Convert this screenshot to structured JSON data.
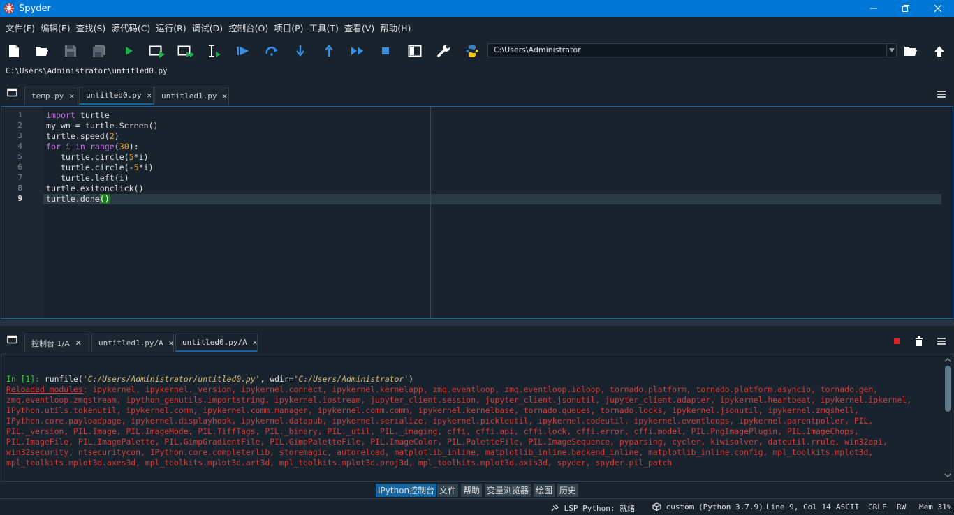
{
  "window": {
    "title": "Spyder"
  },
  "menu": [
    "文件(F)",
    "编辑(E)",
    "查找(S)",
    "源代码(C)",
    "运行(R)",
    "调试(D)",
    "控制台(O)",
    "项目(P)",
    "工具(T)",
    "查看(V)",
    "帮助(H)"
  ],
  "toolbar": {
    "working_dir": "C:\\Users\\Administrator"
  },
  "editor": {
    "file_path": "C:\\Users\\Administrator\\untitled0.py",
    "tabs": [
      {
        "label": "temp.py"
      },
      {
        "label": "untitled0.py",
        "active": true
      },
      {
        "label": "untitled1.py"
      }
    ],
    "current_line": 9,
    "lines": [
      "import turtle",
      "my_wn = turtle.Screen()",
      "turtle.speed(2)",
      "for i in range(30):",
      "   turtle.circle(5*i)",
      "   turtle.circle(-5*i)",
      "   turtle.left(i)",
      "turtle.exitonclick()",
      "turtle.done()"
    ]
  },
  "console": {
    "tabs": [
      {
        "label": "控制台 1/A"
      },
      {
        "label": "untitled1.py/A"
      },
      {
        "label": "untitled0.py/A",
        "active": true
      }
    ],
    "prompt": "In [1]:",
    "run_cmd_pre": " runfile(",
    "run_file_arg": "'C:/Users/Administrator/untitled0.py'",
    "run_mid": ", wdir=",
    "run_wdir_arg": "'C:/Users/Administrator'",
    "run_end": ")",
    "reloaded_label": "Reloaded modules",
    "reloaded_lines": [
      ": ipykernel, ipykernel._version, ipykernel.connect, ipykernel.kernelapp, zmq.eventloop, zmq.eventloop.ioloop, tornado.platform, tornado.platform.asyncio, tornado.gen,",
      "zmq.eventloop.zmqstream, ipython_genutils.importstring, ipykernel.iostream, jupyter_client.session, jupyter_client.jsonutil, jupyter_client.adapter, ipykernel.heartbeat, ipykernel.ipkernel,",
      "IPython.utils.tokenutil, ipykernel.comm, ipykernel.comm.manager, ipykernel.comm.comm, ipykernel.kernelbase, tornado.queues, tornado.locks, ipykernel.jsonutil, ipykernel.zmqshell,",
      "IPython.core.payloadpage, ipykernel.displayhook, ipykernel.datapub, ipykernel.serialize, ipykernel.pickleutil, ipykernel.codeutil, ipykernel.eventloops, ipykernel.parentpoller, PIL,",
      "PIL._version, PIL.Image, PIL.ImageMode, PIL.TiffTags, PIL._binary, PIL._util, PIL._imaging, cffi, cffi.api, cffi.lock, cffi.error, cffi.model, PIL.PngImagePlugin, PIL.ImageChops,",
      "PIL.ImageFile, PIL.ImagePalette, PIL.GimpGradientFile, PIL.GimpPaletteFile, PIL.ImageColor, PIL.PaletteFile, PIL.ImageSequence, pyparsing, cycler, kiwisolver, dateutil.rrule, win32api,",
      "win32security, ntsecuritycon, IPython.core.completerlib, storemagic, autoreload, matplotlib_inline, matplotlib_inline.backend_inline, matplotlib_inline.config, mpl_toolkits.mplot3d,",
      "mpl_toolkits.mplot3d.axes3d, mpl_toolkits.mplot3d.art3d, mpl_toolkits.mplot3d.proj3d, mpl_toolkits.mplot3d.axis3d, spyder, spyder.pil_patch"
    ]
  },
  "pane_tabs": [
    "IPython控制台",
    "文件",
    "帮助",
    "变量浏览器",
    "绘图",
    "历史"
  ],
  "status": {
    "lsp": "LSP Python: 就绪",
    "env": "custom (Python 3.7.9)",
    "position": "Line 9, Col 14",
    "encoding": "ASCII",
    "eol": "CRLF",
    "rw": "RW",
    "mem": "Mem 31%"
  },
  "colors": {
    "accent": "#1464a0",
    "titlebar": "#0078d7",
    "background": "#19232d",
    "error_text": "#d43c3c",
    "prompt": "#31d131"
  }
}
